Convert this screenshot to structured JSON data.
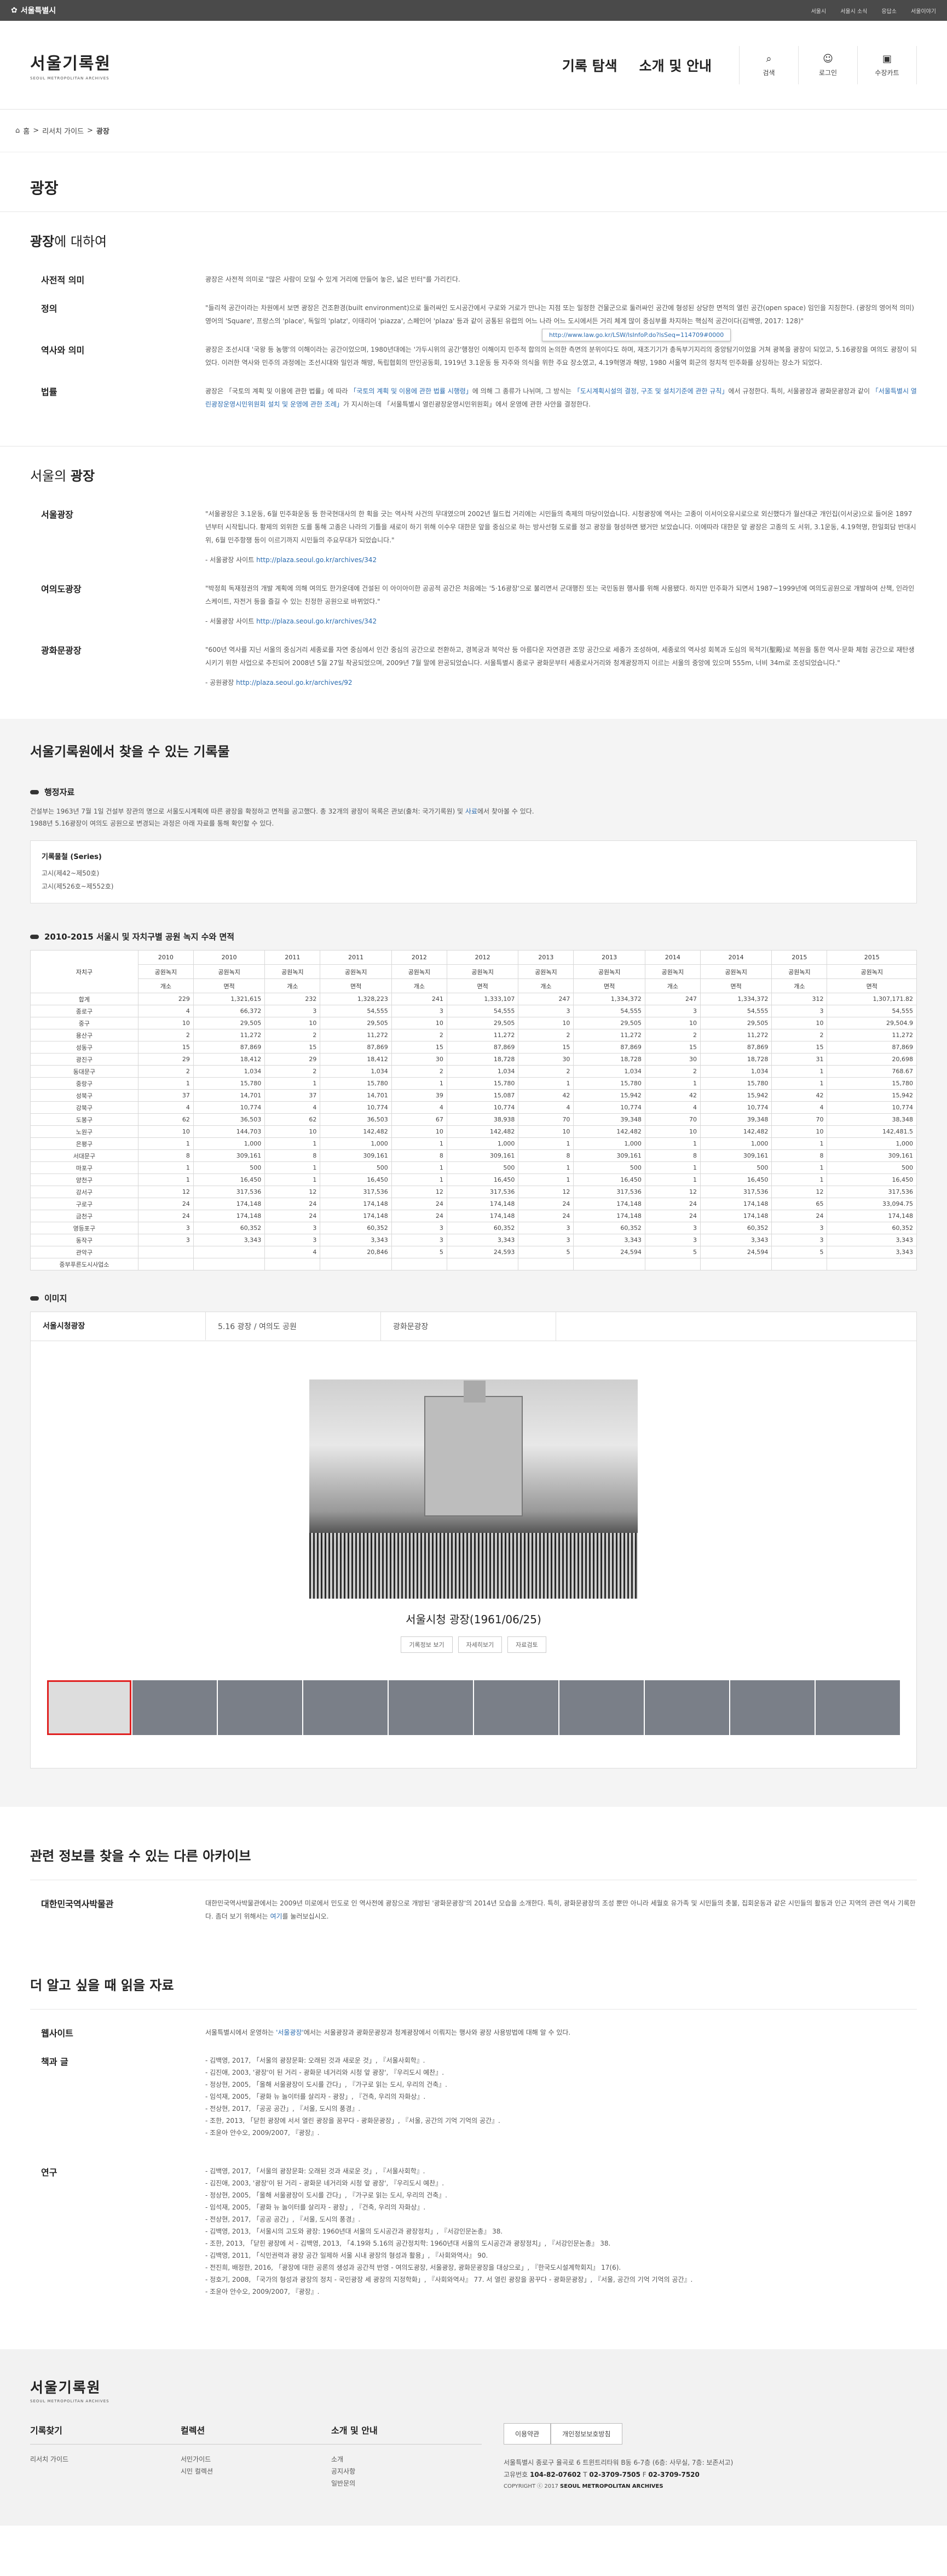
{
  "topbar": {
    "brand": "서울특별시",
    "links": [
      "서울시",
      "서울시 소식",
      "응답소",
      "서울이야기"
    ]
  },
  "header": {
    "logo": "서울기록원",
    "logo_sub": "SEOUL METROPOLITAN ARCHIVES",
    "nav": [
      "기록 탐색",
      "소개 및 안내"
    ],
    "utils": [
      {
        "label": "검색",
        "icon": "search"
      },
      {
        "label": "로그인",
        "icon": "user"
      },
      {
        "label": "수장카트",
        "icon": "cart"
      }
    ]
  },
  "breadcrumb": [
    "홈",
    "리서치 가이드",
    "광장"
  ],
  "page_title": "광장",
  "about": {
    "title_strong": "광장",
    "title_rest": "에 대하여",
    "items": [
      {
        "term": "사전적 의미",
        "desc": "광장은 사전적 의미로 \"많은 사람이 모일 수 있게 거리에 만들어 놓은, 넓은 빈터\"를 가리킨다."
      },
      {
        "term": "정의",
        "desc": "\"들리적 공간이라는 차원에서 보면 광장은 건조환경(built environment)으로 둘러싸인 도시공간에서 구로와 거로가 만나는 지점 또는 일정한 건물군으로 둘러싸인 공간에 형성된 상당한 면적의 열린 공간(open space) 임인을 지칭한다. (광장의 영어적 의미) 영어의 'Square', 프랑스의 'place', 독일의 'platz', 이태리어 'piazza', 스페인어 'plaza' 등과 같이 공통된 유럽의 어느 나라 어느 도시에서든 거리 체계 많이 중심부를 차지하는 핵심적 공간이다(김백영, 2017: 128)\""
      },
      {
        "term": "역사와 의미",
        "desc": "광장은 조선시대 '국왕 등 농행'의 이해이라는 공간이었으며, 1980년대에는 '가두시위의 공간'행정인 이해이지 민주적 합의의 논의한 측면의 분위이다도 하며, 재조기기가 총독부기지리의 중앙탐기이었을 거쳐 광복을 광장이 되었고, 5.16광장을 여의도 광장이 되었다. 이러한 역사와 민주의 과정에는 조선시대와 일인과 해방, 독립협회의 만인공동회, 1919년 3.1운동 등 자주와 의식을 위한 주요 장소였고, 4.19혁명과 해방, 1980 서울역 회군의 정치적 민주화를 상징하는 장소가 되었다."
      },
      {
        "term": "법률",
        "desc_parts": [
          "광장은 「국토의 계획 및 이용에 관한 법률」에 따라 ",
          "「국토의 계획 및 이용에 관한 법률 시행령」",
          "에 의해 그 종류가 나뉘며, 그 방식는 ",
          "「도시계획시설의 결정, 구조 및 설치기준에 관한 규칙」",
          "에서 규정한다. 특히, 서울광장과 광화문광장과 같이 ",
          "「서울특별시 열린광장운영시민위원회 설치 및 운영에 관한 조례」",
          "가 지시하는데 「서울특별시 열린광장운영시민위원회」에서 운영에 관한 사안을 결정한다."
        ]
      }
    ],
    "tooltip": "http://www.law.go.kr/LSW/lsInfoP.do?lsSeq=114709#0000"
  },
  "seoul_squares": {
    "title_pre": "서울의 ",
    "title_strong": "광장",
    "items": [
      {
        "term": "서울광장",
        "desc": "\"서울광장은 3.1운동, 6월 민주화운동 등 한국현대사의 한 획을 긋는 역사적 사건의 무대였으며 2002년 월드컵 거리에는 시민들의 축제의 마당이었습니다. 시청광장에 역사는 고종이 이서이오유시로으로 외신했다가 월산대군 개인집(이서궁)으로 들어온 1897년부터 시작됩니다. 황제의 외위한 도를 통해 고종은 나라의 기틀을 새로이 하기 위해 이수우 대한문 앞을 중심으로 하는 방사선형 도로를 정고 광장을 형성하면 됐거만 보았습니다. 이에따라 대한문 앞 광장은 고종의 도 서위, 3.1운동, 4.19혁명, 한일회담 반대시위, 6월 민주항쟁 등이 이르기까지 시민들의 주요무대가 되었습니다.\"",
        "link_label": "- 서울광장 사이트",
        "link": "http://plaza.seoul.go.kr/archives/342"
      },
      {
        "term": "여의도광장",
        "desc": "\"박정희 독재정권의 개발 계획에 의해 여의도 한가운데에 건설된 이 아이아이한 공공적 공간은 처음에는 '5·16광장'으로 불리면서 군대행진 또는 국민동원 행사를 위해 사용됐다. 하지만 민주화가 되면서 1987~1999년에 여의도공원으로 개발하여 산책, 인라인 스케이트, 자전거 등을 즐길 수 있는 친정한 공원으로 바뀌었다.\"",
        "link_label": "- 서울광장 사이트",
        "link": "http://plaza.seoul.go.kr/archives/342"
      },
      {
        "term": "광화문광장",
        "desc": "\"600년 역사를 지닌 서울의 중심거리 세종로를 자연 중심에서 인간 중심의 공간으로 전환하고, 경복궁과 북악산 등 아름다운 자연경관 조망 공간으로 세종가 조성하여, 세종로의 역사성 회복과 도심의 목적기(聖殿)로 복원을 통한 역사·문화 체험 공간으로 재탄생시키기 위한 사업으로 추진되어 2008년 5월 27일 착공되었으며, 2009년 7월 말에 완공되었습니다. 서울특별시 종로구 광화문부터 세종로사거리와 청계광장까지 이르는 서울의 중앙에 있으며 555m, 너비 34m로 조성되었습니다.\"",
        "link_label": "- 공원광장",
        "link": "http://plaza.seoul.go.kr/archives/92"
      }
    ]
  },
  "records": {
    "title": "서울기록원에서 찾을 수 있는 기록물",
    "admin_title": "행정자료",
    "admin_text_1": "건설부는 1963년 7월 1일 건설부 장관의 명으로 서울도시계획에 따른 광장을 확정하고 면적을 공고했다. 총 32개의 광장이 목록은 관보(출처: 국가기록원) 및 ",
    "admin_link": "사료",
    "admin_text_2": "에서 찾아볼 수 있다.",
    "admin_text_3": "1988년 5.16광장이 여의도 공원으로 변경되는 과정은 아래 자료를 통해 확인할 수 있다.",
    "series_title": "기록물철 (Series)",
    "series": [
      "고시(제42~제50호)",
      "고시(제526호~제552호)"
    ],
    "stats_title": "2010-2015 서울시 및 자치구별 공원 녹지 수와 면적",
    "stats_header_label": "자치구",
    "years": [
      "2010",
      "2010",
      "2011",
      "2011",
      "2012",
      "2012",
      "2013",
      "2013",
      "2014",
      "2014",
      "2015",
      "2015"
    ],
    "sub1": [
      "공원녹지",
      "공원녹지",
      "공원녹지",
      "공원녹지",
      "공원녹지",
      "공원녹지",
      "공원녹지",
      "공원녹지",
      "공원녹지",
      "공원녹지",
      "공원녹지",
      "공원녹지"
    ],
    "sub2": [
      "개소",
      "면적",
      "개소",
      "면적",
      "개소",
      "면적",
      "개소",
      "면적",
      "개소",
      "면적",
      "개소",
      "면적"
    ],
    "rows": [
      [
        "합계",
        "229",
        "1,321,615",
        "232",
        "1,328,223",
        "241",
        "1,333,107",
        "247",
        "1,334,372",
        "247",
        "1,334,372",
        "312",
        "1,307,171.82"
      ],
      [
        "종로구",
        "4",
        "66,372",
        "3",
        "54,555",
        "3",
        "54,555",
        "3",
        "54,555",
        "3",
        "54,555",
        "3",
        "54,555"
      ],
      [
        "중구",
        "10",
        "29,505",
        "10",
        "29,505",
        "10",
        "29,505",
        "10",
        "29,505",
        "10",
        "29,505",
        "10",
        "29,504.9"
      ],
      [
        "용산구",
        "2",
        "11,272",
        "2",
        "11,272",
        "2",
        "11,272",
        "2",
        "11,272",
        "2",
        "11,272",
        "2",
        "11,272"
      ],
      [
        "성동구",
        "15",
        "87,869",
        "15",
        "87,869",
        "15",
        "87,869",
        "15",
        "87,869",
        "15",
        "87,869",
        "15",
        "87,869"
      ],
      [
        "광진구",
        "29",
        "18,412",
        "29",
        "18,412",
        "30",
        "18,728",
        "30",
        "18,728",
        "30",
        "18,728",
        "31",
        "20,698"
      ],
      [
        "동대문구",
        "2",
        "1,034",
        "2",
        "1,034",
        "2",
        "1,034",
        "2",
        "1,034",
        "2",
        "1,034",
        "1",
        "768.67"
      ],
      [
        "중랑구",
        "1",
        "15,780",
        "1",
        "15,780",
        "1",
        "15,780",
        "1",
        "15,780",
        "1",
        "15,780",
        "1",
        "15,780"
      ],
      [
        "성북구",
        "37",
        "14,701",
        "37",
        "14,701",
        "39",
        "15,087",
        "42",
        "15,942",
        "42",
        "15,942",
        "42",
        "15,942"
      ],
      [
        "강북구",
        "4",
        "10,774",
        "4",
        "10,774",
        "4",
        "10,774",
        "4",
        "10,774",
        "4",
        "10,774",
        "4",
        "10,774"
      ],
      [
        "도봉구",
        "62",
        "36,503",
        "62",
        "36,503",
        "67",
        "38,938",
        "70",
        "39,348",
        "70",
        "39,348",
        "70",
        "38,348"
      ],
      [
        "노원구",
        "10",
        "144,703",
        "10",
        "142,482",
        "10",
        "142,482",
        "10",
        "142,482",
        "10",
        "142,482",
        "10",
        "142,481.5"
      ],
      [
        "은평구",
        "1",
        "1,000",
        "1",
        "1,000",
        "1",
        "1,000",
        "1",
        "1,000",
        "1",
        "1,000",
        "1",
        "1,000"
      ],
      [
        "서대문구",
        "8",
        "309,161",
        "8",
        "309,161",
        "8",
        "309,161",
        "8",
        "309,161",
        "8",
        "309,161",
        "8",
        "309,161"
      ],
      [
        "마포구",
        "1",
        "500",
        "1",
        "500",
        "1",
        "500",
        "1",
        "500",
        "1",
        "500",
        "1",
        "500"
      ],
      [
        "양천구",
        "1",
        "16,450",
        "1",
        "16,450",
        "1",
        "16,450",
        "1",
        "16,450",
        "1",
        "16,450",
        "1",
        "16,450"
      ],
      [
        "강서구",
        "12",
        "317,536",
        "12",
        "317,536",
        "12",
        "317,536",
        "12",
        "317,536",
        "12",
        "317,536",
        "12",
        "317,536"
      ],
      [
        "구로구",
        "24",
        "174,148",
        "24",
        "174,148",
        "24",
        "174,148",
        "24",
        "174,148",
        "24",
        "174,148",
        "65",
        "33,094.75"
      ],
      [
        "금천구",
        "24",
        "174,148",
        "24",
        "174,148",
        "24",
        "174,148",
        "24",
        "174,148",
        "24",
        "174,148",
        "24",
        "174,148"
      ],
      [
        "영등포구",
        "3",
        "60,352",
        "3",
        "60,352",
        "3",
        "60,352",
        "3",
        "60,352",
        "3",
        "60,352",
        "3",
        "60,352"
      ],
      [
        "동작구",
        "3",
        "3,343",
        "3",
        "3,343",
        "3",
        "3,343",
        "3",
        "3,343",
        "3",
        "3,343",
        "3",
        "3,343"
      ],
      [
        "관악구",
        "",
        "",
        "4",
        "20,846",
        "5",
        "24,593",
        "5",
        "24,594",
        "5",
        "24,594",
        "5",
        "3,343"
      ],
      [
        "중부푸른도시사업소",
        "",
        "",
        "",
        "",
        "",
        "",
        "",
        "",
        "",
        "",
        "",
        ""
      ]
    ],
    "images_title": "이미지",
    "tabs": [
      "서울시청광장",
      "5.16 광장 / 여의도 공원",
      "광화문광장"
    ],
    "caption": "서울시청 광장(1961/06/25)",
    "buttons": [
      "기록정보 보기",
      "자세히보기",
      "자료검토"
    ],
    "thumb_count": 10
  },
  "archives": {
    "title": "관련 정보를 찾을 수 있는 다른 아카이브",
    "term": "대한민국역사박물관",
    "desc_1": "대한민국역사박물관에서는 2009년 미로에서 민도로 인 역사전에 광장으로 개방된 '광화문광장'의 2014년 모습을 소개한다. 특히, 광화문광장의 조성 뿐만 아니라 세월호 유가족 및 시민들의 촛불, 집회운동과 같은 시민들의 활동과 인근 지역의 관련 역사 기록한다. 좀더 보기 위해서는 ",
    "desc_link": "여기",
    "desc_2": "를 눌러보십시오."
  },
  "more": {
    "title": "더 알고 싶을 때 읽을 자료",
    "website_term": "웹사이트",
    "website_1": "서울특별시에서 운영하는 ",
    "website_link": "'서울광장'",
    "website_2": "에서는 서울광장과 광화문광장과 청계광장에서 이뤄지는 행사와 광장 사용방법에 대해 알 수 있다.",
    "books_term": "책과 글",
    "books": [
      "- 김백영, 2017, 「서울의 광장문화: 오래된 것과 새로운 것」, 『서울사회학』.",
      "- 김진애, 2003, '광장'이 된 거리 - 광화문 네거리와 시청 앞 광장', 『우리도시 예찬』.",
      "- 정상현, 2005, 「올해 서울광장이 도시를 간다」, 『가구로 읽는 도시, 우리의 건축』.",
      "- 임석재, 2005, 「광화 뉴 놀이터를 살리자 - 광장」, 『건축, 우리의 자화상』.",
      "- 전상현, 2017, 「공공 공간」, 『서울, 도시의 풍경』.",
      "- 조한, 2013, 「닫힌 광장에 서서 열린 광장을 꿈꾸다 - 광화문광장」, 『서울, 공간의 기억 기억의 공간』.",
      "- 조윤아 안수오, 2009/2007, 『광장』."
    ],
    "research_term": "연구",
    "research": [
      "- 김백영, 2017, 「서울의 광장문화: 오래된 것과 새로운 것」, 『서울사회학』.",
      "- 김진애, 2003, '광장'이 된 거리 - 광화문 네거리와 시청 앞 광장', 『우리도시 예찬』.",
      "- 정상현, 2005, 「올해 서울광장이 도시를 간다」, 『가구로 읽는 도시, 우리의 건축』.",
      "- 임석재, 2005, 「광화 뉴 놀이터를 살리자 - 광장」, 『건축, 우리의 자화상』.",
      "- 전상현, 2017, 「공공 공간」, 『서울, 도시의 풍경』.",
      "- 김백영, 2013, 「서울시의 고도와 광장: 1960년대 서울의 도시공간과 광장정치」, 『서강인문논총』 38.",
      "- 조한, 2013, 「닫힌 광장에 서 - 김백영, 2013, 「4.19와 5.16의 공간정치학: 1960년대 서울의 도시공간과 광장정치」, 『서강인문논총』 38.",
      "- 김백영, 2011, 「식민권력과 광장 공간 일제하 서울 시내 광장의 형성과 활용」, 『사회와역사』 90.",
      "- 전진희, 배정한, 2016, 「광장에 대한 공론의 생성과 공간적 반영 - 여의도광장, 서울광장, 광화문광장을 대상으로」, 『한국도시설계학회지』 17(6).",
      "- 정호기, 2008, 「국가의 형성과 광장의 정치 - 국민광장 세 광장의 지정학화」, 『사회와역사』 77. 서 열린 광장을 꿈꾸다 - 광화문광장」, 『서울, 공간의 기억 기억의 공간』.",
      "- 조윤아 안수오, 2009/2007, 『광장』."
    ]
  },
  "footer": {
    "logo": "서울기록원",
    "logo_sub": "SEOUL METROPOLITAN ARCHIVES",
    "cols": [
      {
        "title": "기록찾기",
        "items": [
          "리서치 가이드"
        ]
      },
      {
        "title": "컬렉션",
        "items": [
          "서민가이드",
          "시민 컬렉션"
        ]
      },
      {
        "title": "소개 및 안내",
        "items": [
          "소개",
          "공지사항",
          "일반문의"
        ]
      }
    ],
    "btns": [
      "이용약관",
      "개인정보보호방침"
    ],
    "address": "서울특별시 종로구 율곡로 6 트윈트리타워 B동 6-7층 (6층: 사무실, 7층: 보존서고)",
    "phone_label": "고유번호 ",
    "phone": "104-82-07602",
    "tel_label": " T ",
    "tel": "02-3709-7505",
    "fax_label": " F ",
    "fax": "02-3709-7520",
    "copyright": "COPYRIGHT ⓒ 2017 ",
    "copyright_strong": "SEOUL METROPOLITAN ARCHIVES"
  }
}
